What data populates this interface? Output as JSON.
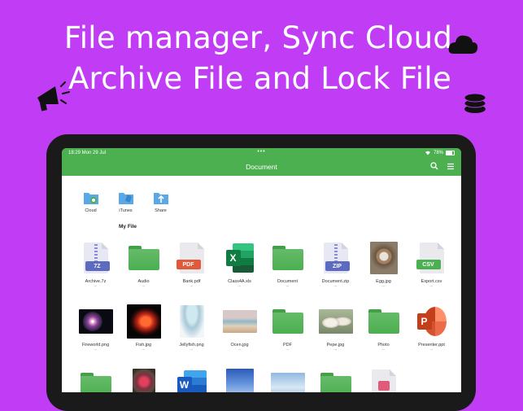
{
  "headline": {
    "line1": "File manager, Sync Cloud",
    "line2": "Archive File and Lock File"
  },
  "status": {
    "time": "18:29  Mon 29 Jul",
    "dots": "•••",
    "battery": "78%"
  },
  "nav": {
    "title": "Document"
  },
  "quick_access": [
    {
      "label": "Cloud",
      "icon": "cloud-folder-icon"
    },
    {
      "label": "iTunes",
      "icon": "itunes-folder-icon"
    },
    {
      "label": "Share",
      "icon": "share-folder-icon"
    }
  ],
  "section": {
    "my_file": "My File"
  },
  "files": {
    "row1": [
      {
        "name": "Archive.7z",
        "sub": "...",
        "type": "7z-archive-icon"
      },
      {
        "name": "Audio",
        "sub": "...",
        "type": "folder-icon"
      },
      {
        "name": "Bank.pdf",
        "sub": "...",
        "type": "pdf-icon"
      },
      {
        "name": "Class4A.xls",
        "sub": "...",
        "type": "excel-icon"
      },
      {
        "name": "Document",
        "sub": "...",
        "type": "folder-icon"
      },
      {
        "name": "Document.zip",
        "sub": "...",
        "type": "zip-archive-icon"
      },
      {
        "name": "Egg.jpg",
        "sub": "...",
        "type": "photo-thumbnail"
      },
      {
        "name": "Export.csv",
        "sub": "...",
        "type": "csv-icon"
      }
    ],
    "row2": [
      {
        "name": "Fireworld.png",
        "sub": "...",
        "type": "photo-thumbnail"
      },
      {
        "name": "Fish.jpg",
        "sub": "...",
        "type": "photo-thumbnail"
      },
      {
        "name": "Jellyfish.png",
        "sub": "...",
        "type": "photo-thumbnail"
      },
      {
        "name": "Ocen.jpg",
        "sub": "...",
        "type": "photo-thumbnail"
      },
      {
        "name": "PDF",
        "sub": "...",
        "type": "folder-icon"
      },
      {
        "name": "Pepe.jpg",
        "sub": "...",
        "type": "photo-thumbnail"
      },
      {
        "name": "Photo",
        "sub": "...",
        "type": "folder-icon"
      },
      {
        "name": "Presenter.ppt",
        "sub": "...",
        "type": "powerpoint-icon"
      }
    ]
  },
  "badges": {
    "sevenz": "7Z",
    "pdf": "PDF",
    "zip": "ZIP",
    "csv": "CSV",
    "xls": "X",
    "ppt": "P",
    "word": "W"
  },
  "colors": {
    "background": "#c03df5",
    "accent": "#4caf50",
    "folder": "#5cb85c"
  }
}
